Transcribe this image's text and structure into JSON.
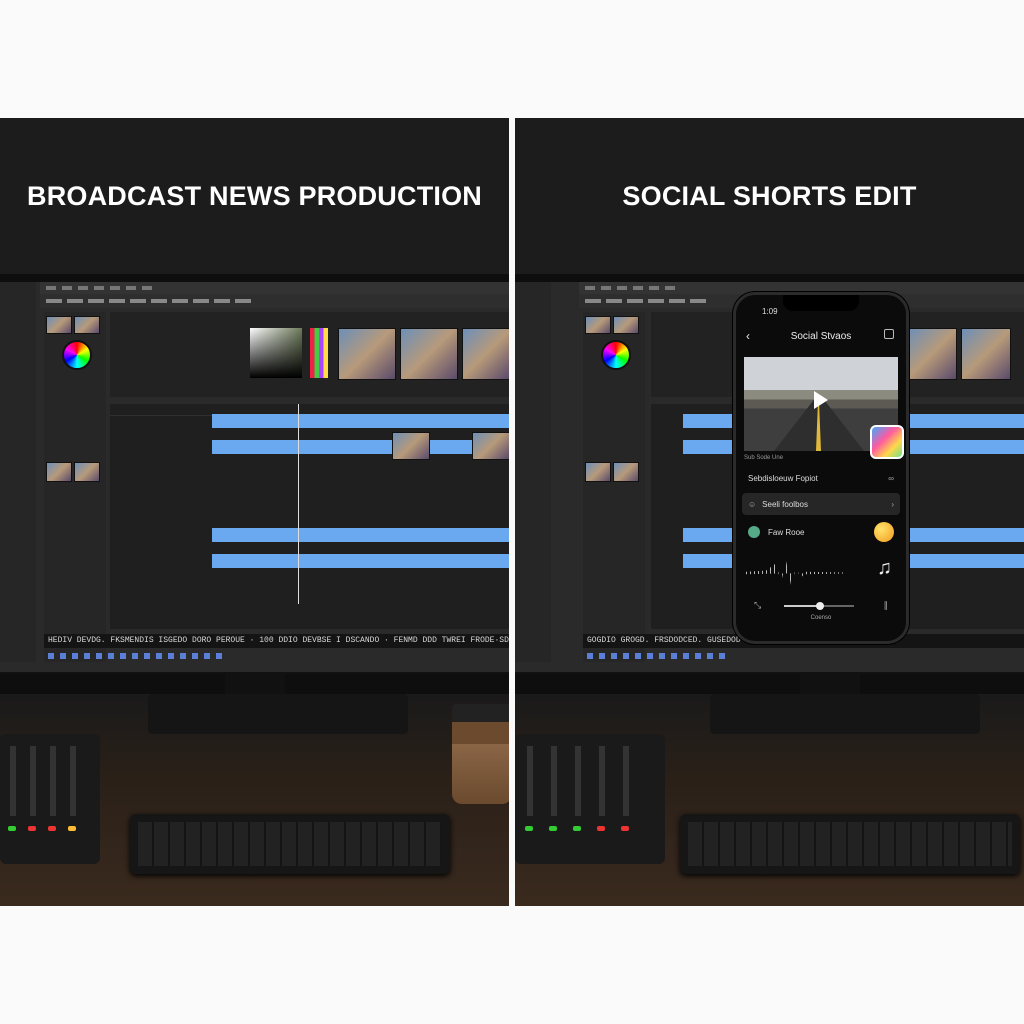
{
  "left_panel": {
    "heading": "BROADCAST NEWS PRODUCTION",
    "status_text": "HEDIV DEVDG. FKSMENDIS ISGEDO DORO PEROUE · 100 DDIO DEVBSE I DSCANDO ·  FENMD DDD TWREI FRODE·SDDIS"
  },
  "right_panel": {
    "heading": "SOCIAL SHORTS EDIT",
    "status_text": "GOGDIO GROGD. FRSDODCED. GUSEDOD  BMPRSGIO SO· VFTADDD TOSOVE",
    "phone": {
      "time": "1:09",
      "title": "Social Stvaos",
      "video_sub": "Sub Sode Une",
      "row1_label": "Sebdisloeuw Fopiot",
      "row2_label": "Seeli foolbos",
      "row3_label": "Faw Rooe",
      "footer": "Coenso"
    }
  }
}
